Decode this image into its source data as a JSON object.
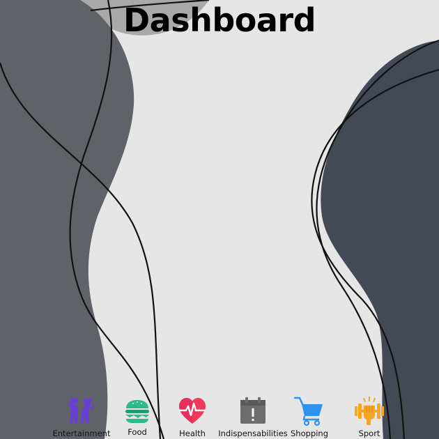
{
  "page": {
    "title": "Dashboard"
  },
  "colors": {
    "background": "#e6e6e6",
    "left_shape": "#5f6368",
    "right_shape": "#444a55",
    "top_blob": "#a9a9a9"
  },
  "categories": [
    {
      "label": "Entertainment",
      "icon": "people-celebrating-icon",
      "color": "#6a3fd8"
    },
    {
      "label": "Food",
      "icon": "burger-icon",
      "color": "#2dbb8a"
    },
    {
      "label": "Health",
      "icon": "heart-pulse-icon",
      "color": "#f03a5b"
    },
    {
      "label": "Indispensabilities",
      "icon": "calendar-alert-icon",
      "color": "#6d6d6d"
    },
    {
      "label": "Shopping",
      "icon": "shopping-cart-icon",
      "color": "#2f93f0"
    },
    {
      "label": "Sport",
      "icon": "dumbbell-fist-icon",
      "color": "#f6a623"
    }
  ]
}
